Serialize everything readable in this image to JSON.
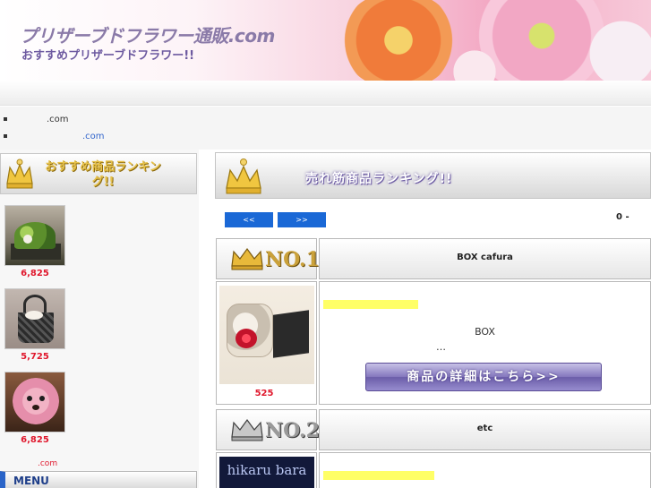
{
  "header": {
    "site_title": "プリザーブドフラワー通販.com",
    "subtitle": "おすすめプリザーブドフラワー!!"
  },
  "links": [
    {
      "text": ".com"
    },
    {
      "text": ".com"
    }
  ],
  "sidebar": {
    "heading": "おすすめ商品ランキング!!",
    "items": [
      {
        "price": "6,825",
        "image": "green-arrangement"
      },
      {
        "price": "5,725",
        "image": "black-basket"
      },
      {
        "price": "6,825",
        "image": "pink-poodle"
      }
    ],
    "footer_link": ".com",
    "menu_label": "MENU"
  },
  "main": {
    "heading": "売れ筋商品ランキング!!",
    "prev_label": "<<",
    "next_label": ">>",
    "page_count": "0 -",
    "ranks": [
      {
        "rank_label": "NO.1",
        "name": "BOX cafura"
      },
      {
        "rank_label": "NO.2",
        "name": "etc"
      }
    ],
    "product": {
      "price": "525",
      "desc_line1": "BOX",
      "desc_line2": "…",
      "detail_button": "商品の詳細はこちら>>"
    },
    "third_image_text": "hikaru bara"
  },
  "colors": {
    "accent_blue": "#1a68d6",
    "price_red": "#e0182d",
    "menu_blue": "#2a64c8",
    "button_purple": "#7a6cb6"
  }
}
